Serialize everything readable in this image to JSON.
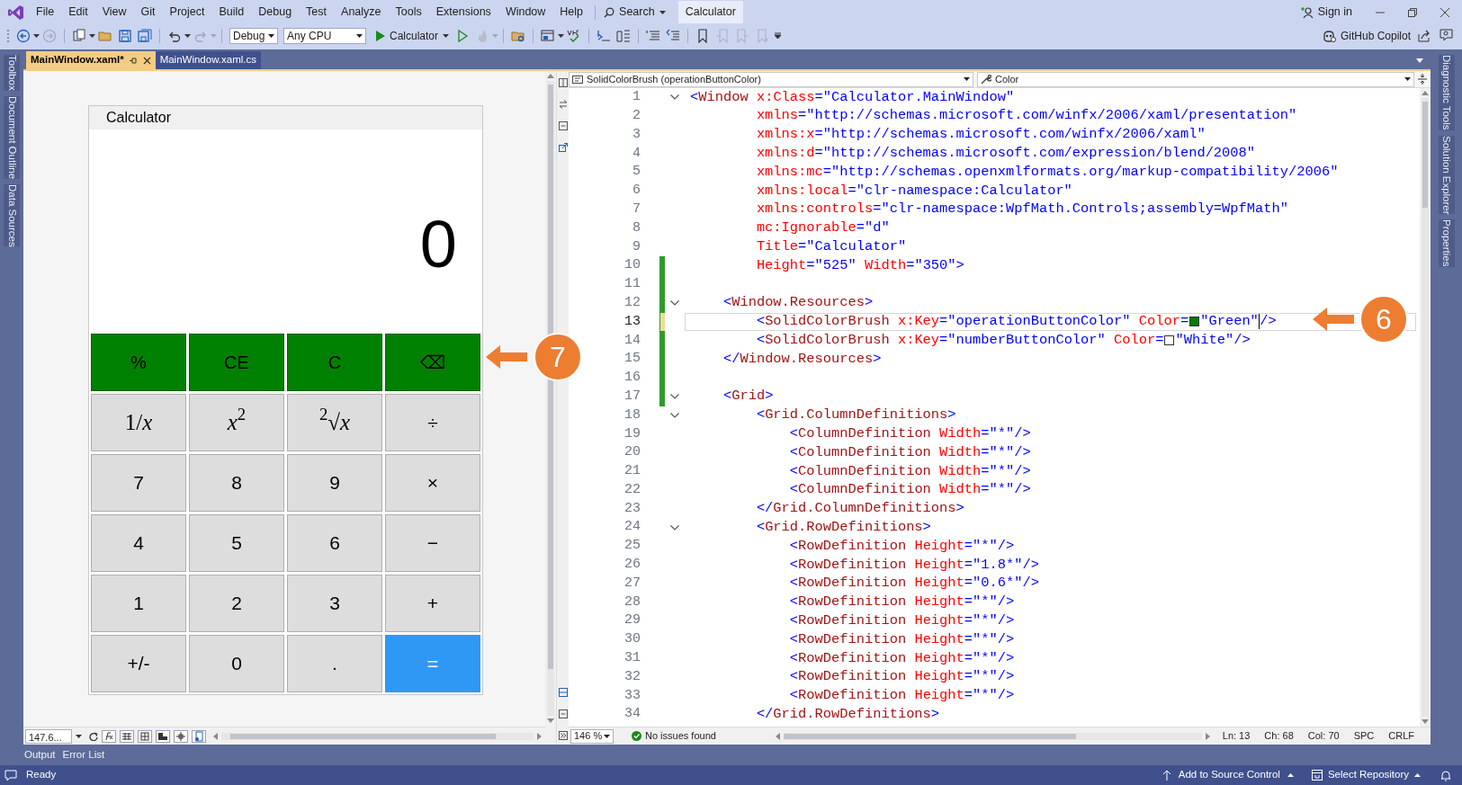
{
  "menu_bar": {
    "items": [
      "File",
      "Edit",
      "View",
      "Git",
      "Project",
      "Build",
      "Debug",
      "Test",
      "Analyze",
      "Tools",
      "Extensions",
      "Window",
      "Help"
    ],
    "search": "Search",
    "solution": "Calculator",
    "sign_in": "Sign in"
  },
  "toolbar": {
    "configuration": "Debug",
    "platform": "Any CPU",
    "start": "Calculator",
    "copilot": "GitHub Copilot"
  },
  "left_tool_tabs": [
    "Toolbox",
    "Document Outline",
    "Data Sources"
  ],
  "document_tabs": [
    {
      "label": "MainWindow.xaml*",
      "selected": true
    },
    {
      "label": "MainWindow.xaml.cs",
      "selected": false
    }
  ],
  "designer": {
    "window_title": "Calculator",
    "display": "0",
    "zoom": "147.6...",
    "buttons": [
      {
        "label": "%",
        "kind": "operation"
      },
      {
        "label": "CE",
        "kind": "operation"
      },
      {
        "label": "C",
        "kind": "operation"
      },
      {
        "label": "⌫",
        "kind": "operation"
      },
      {
        "label": "1/*x*",
        "kind": "function"
      },
      {
        "label": "*x*$^{2}$",
        "kind": "function"
      },
      {
        "label": "$^{2}$√*x*",
        "kind": "function"
      },
      {
        "label": "÷",
        "kind": "number"
      },
      {
        "label": "7",
        "kind": "number"
      },
      {
        "label": "8",
        "kind": "number"
      },
      {
        "label": "9",
        "kind": "number"
      },
      {
        "label": "×",
        "kind": "number"
      },
      {
        "label": "4",
        "kind": "number"
      },
      {
        "label": "5",
        "kind": "number"
      },
      {
        "label": "6",
        "kind": "number"
      },
      {
        "label": "−",
        "kind": "number"
      },
      {
        "label": "1",
        "kind": "number"
      },
      {
        "label": "2",
        "kind": "number"
      },
      {
        "label": "3",
        "kind": "number"
      },
      {
        "label": "+",
        "kind": "number"
      },
      {
        "label": "+/-",
        "kind": "number"
      },
      {
        "label": "0",
        "kind": "number"
      },
      {
        "label": ".",
        "kind": "number"
      },
      {
        "label": "=",
        "kind": "equals"
      }
    ]
  },
  "editor": {
    "member_dropdown": "SolidColorBrush (operationButtonColor)",
    "property_dropdown": "Color",
    "zoom": "146 %",
    "issues": "No issues found",
    "position": [
      "Ln: 13",
      "Ch: 68",
      "Col: 70",
      "SPC",
      "CRLF"
    ],
    "lines": [
      {
        "number": "1",
        "fold": true,
        "changed": false,
        "unsaved": false,
        "current": false,
        "tokens": [
          {
            "kind": "punct",
            "text": "<"
          },
          {
            "kind": "element",
            "text": "Window"
          },
          {
            "kind": "attr",
            "text": " x:Class"
          },
          {
            "kind": "value",
            "text": "=\"Calculator.MainWindow\""
          }
        ]
      },
      {
        "number": "2",
        "fold": false,
        "changed": false,
        "unsaved": false,
        "current": false,
        "tokens": [
          {
            "kind": "attr",
            "text": "        xmlns"
          },
          {
            "kind": "value",
            "text": "=\"http://schemas.microsoft.com/winfx/2006/xaml/presentation\""
          }
        ]
      },
      {
        "number": "3",
        "fold": false,
        "changed": false,
        "unsaved": false,
        "current": false,
        "tokens": [
          {
            "kind": "attr",
            "text": "        xmlns:x"
          },
          {
            "kind": "value",
            "text": "=\"http://schemas.microsoft.com/winfx/2006/xaml\""
          }
        ]
      },
      {
        "number": "4",
        "fold": false,
        "changed": false,
        "unsaved": false,
        "current": false,
        "tokens": [
          {
            "kind": "attr",
            "text": "        xmlns:d"
          },
          {
            "kind": "value",
            "text": "=\"http://schemas.microsoft.com/expression/blend/2008\""
          }
        ]
      },
      {
        "number": "5",
        "fold": false,
        "changed": false,
        "unsaved": false,
        "current": false,
        "tokens": [
          {
            "kind": "attr",
            "text": "        xmlns:mc"
          },
          {
            "kind": "value",
            "text": "=\"http://schemas.openxmlformats.org/markup-compatibility/2006\""
          }
        ]
      },
      {
        "number": "6",
        "fold": false,
        "changed": false,
        "unsaved": false,
        "current": false,
        "tokens": [
          {
            "kind": "attr",
            "text": "        xmlns:local"
          },
          {
            "kind": "value",
            "text": "=\"clr-namespace:Calculator\""
          }
        ]
      },
      {
        "number": "7",
        "fold": false,
        "changed": false,
        "unsaved": false,
        "current": false,
        "tokens": [
          {
            "kind": "attr",
            "text": "        xmlns:controls"
          },
          {
            "kind": "value",
            "text": "=\"clr-namespace:WpfMath.Controls;assembly=WpfMath\""
          }
        ]
      },
      {
        "number": "8",
        "fold": false,
        "changed": false,
        "unsaved": false,
        "current": false,
        "tokens": [
          {
            "kind": "attr",
            "text": "        mc:Ignorable"
          },
          {
            "kind": "value",
            "text": "=\"d\""
          }
        ]
      },
      {
        "number": "9",
        "fold": false,
        "changed": false,
        "unsaved": false,
        "current": false,
        "tokens": [
          {
            "kind": "attr",
            "text": "        Title"
          },
          {
            "kind": "value",
            "text": "=\"Calculator\""
          }
        ]
      },
      {
        "number": "10",
        "fold": false,
        "changed": true,
        "unsaved": false,
        "current": false,
        "tokens": [
          {
            "kind": "attr",
            "text": "        Height"
          },
          {
            "kind": "value",
            "text": "=\"525\""
          },
          {
            "kind": "attr",
            "text": " Width"
          },
          {
            "kind": "value",
            "text": "=\"350\""
          },
          {
            "kind": "punct",
            "text": ">"
          }
        ]
      },
      {
        "number": "11",
        "fold": false,
        "changed": true,
        "unsaved": false,
        "current": false
      },
      {
        "number": "12",
        "fold": true,
        "changed": true,
        "unsaved": false,
        "current": false,
        "tokens": [
          {
            "kind": "punct",
            "text": "    <"
          },
          {
            "kind": "element",
            "text": "Window.Resources"
          },
          {
            "kind": "punct",
            "text": ">"
          }
        ]
      },
      {
        "number": "13",
        "fold": false,
        "changed": true,
        "unsaved": true,
        "current": true,
        "tokens": [
          {
            "kind": "punct",
            "text": "        <"
          },
          {
            "kind": "element",
            "text": "SolidColorBrush"
          },
          {
            "kind": "attr",
            "text": " x:Key"
          },
          {
            "kind": "value",
            "text": "=\"operationButtonColor\""
          },
          {
            "kind": "attr",
            "text": " Color"
          },
          {
            "kind": "value",
            "text": "="
          },
          {
            "kind": "swatch",
            "color": "#008000"
          },
          {
            "kind": "value",
            "text": "\"Green\""
          },
          {
            "kind": "caret"
          },
          {
            "kind": "punct",
            "text": "/>"
          }
        ]
      },
      {
        "number": "14",
        "fold": false,
        "changed": true,
        "unsaved": false,
        "current": false,
        "tokens": [
          {
            "kind": "punct",
            "text": "        <"
          },
          {
            "kind": "element",
            "text": "SolidColorBrush"
          },
          {
            "kind": "attr",
            "text": " x:Key"
          },
          {
            "kind": "value",
            "text": "=\"numberButtonColor\""
          },
          {
            "kind": "attr",
            "text": " Color"
          },
          {
            "kind": "value",
            "text": "="
          },
          {
            "kind": "swatch",
            "color": "#ffffff"
          },
          {
            "kind": "value",
            "text": "\"White\""
          },
          {
            "kind": "punct",
            "text": "/>"
          }
        ]
      },
      {
        "number": "15",
        "fold": false,
        "changed": true,
        "unsaved": false,
        "current": false,
        "tokens": [
          {
            "kind": "punct",
            "text": "    </"
          },
          {
            "kind": "element",
            "text": "Window.Resources"
          },
          {
            "kind": "punct",
            "text": ">"
          }
        ]
      },
      {
        "number": "16",
        "fold": false,
        "changed": true,
        "unsaved": false,
        "current": false
      },
      {
        "number": "17",
        "fold": true,
        "changed": true,
        "unsaved": false,
        "current": false,
        "tokens": [
          {
            "kind": "punct",
            "text": "    <"
          },
          {
            "kind": "element",
            "text": "Grid"
          },
          {
            "kind": "punct",
            "text": ">"
          }
        ]
      },
      {
        "number": "18",
        "fold": true,
        "changed": false,
        "unsaved": false,
        "current": false,
        "tokens": [
          {
            "kind": "punct",
            "text": "        <"
          },
          {
            "kind": "element",
            "text": "Grid.ColumnDefinitions"
          },
          {
            "kind": "punct",
            "text": ">"
          }
        ]
      },
      {
        "number": "19",
        "fold": false,
        "changed": false,
        "unsaved": false,
        "current": false,
        "tokens": [
          {
            "kind": "punct",
            "text": "            <"
          },
          {
            "kind": "element",
            "text": "ColumnDefinition"
          },
          {
            "kind": "attr",
            "text": " Width"
          },
          {
            "kind": "value",
            "text": "=\"*\""
          },
          {
            "kind": "punct",
            "text": "/>"
          }
        ]
      },
      {
        "number": "20",
        "fold": false,
        "changed": false,
        "unsaved": false,
        "current": false,
        "tokens": [
          {
            "kind": "punct",
            "text": "            <"
          },
          {
            "kind": "element",
            "text": "ColumnDefinition"
          },
          {
            "kind": "attr",
            "text": " Width"
          },
          {
            "kind": "value",
            "text": "=\"*\""
          },
          {
            "kind": "punct",
            "text": "/>"
          }
        ]
      },
      {
        "number": "21",
        "fold": false,
        "changed": false,
        "unsaved": false,
        "current": false,
        "tokens": [
          {
            "kind": "punct",
            "text": "            <"
          },
          {
            "kind": "element",
            "text": "ColumnDefinition"
          },
          {
            "kind": "attr",
            "text": " Width"
          },
          {
            "kind": "value",
            "text": "=\"*\""
          },
          {
            "kind": "punct",
            "text": "/>"
          }
        ]
      },
      {
        "number": "22",
        "fold": false,
        "changed": false,
        "unsaved": false,
        "current": false,
        "tokens": [
          {
            "kind": "punct",
            "text": "            <"
          },
          {
            "kind": "element",
            "text": "ColumnDefinition"
          },
          {
            "kind": "attr",
            "text": " Width"
          },
          {
            "kind": "value",
            "text": "=\"*\""
          },
          {
            "kind": "punct",
            "text": "/>"
          }
        ]
      },
      {
        "number": "23",
        "fold": false,
        "changed": false,
        "unsaved": false,
        "current": false,
        "tokens": [
          {
            "kind": "punct",
            "text": "        </"
          },
          {
            "kind": "element",
            "text": "Grid.ColumnDefinitions"
          },
          {
            "kind": "punct",
            "text": ">"
          }
        ]
      },
      {
        "number": "24",
        "fold": true,
        "changed": false,
        "unsaved": false,
        "current": false,
        "tokens": [
          {
            "kind": "punct",
            "text": "        <"
          },
          {
            "kind": "element",
            "text": "Grid.RowDefinitions"
          },
          {
            "kind": "punct",
            "text": ">"
          }
        ]
      },
      {
        "number": "25",
        "fold": false,
        "changed": false,
        "unsaved": false,
        "current": false,
        "tokens": [
          {
            "kind": "punct",
            "text": "            <"
          },
          {
            "kind": "element",
            "text": "RowDefinition"
          },
          {
            "kind": "attr",
            "text": " Height"
          },
          {
            "kind": "value",
            "text": "=\"*\""
          },
          {
            "kind": "punct",
            "text": "/>"
          }
        ]
      },
      {
        "number": "26",
        "fold": false,
        "changed": false,
        "unsaved": false,
        "current": false,
        "tokens": [
          {
            "kind": "punct",
            "text": "            <"
          },
          {
            "kind": "element",
            "text": "RowDefinition"
          },
          {
            "kind": "attr",
            "text": " Height"
          },
          {
            "kind": "value",
            "text": "=\"1.8*\""
          },
          {
            "kind": "punct",
            "text": "/>"
          }
        ]
      },
      {
        "number": "27",
        "fold": false,
        "changed": false,
        "unsaved": false,
        "current": false,
        "tokens": [
          {
            "kind": "punct",
            "text": "            <"
          },
          {
            "kind": "element",
            "text": "RowDefinition"
          },
          {
            "kind": "attr",
            "text": " Height"
          },
          {
            "kind": "value",
            "text": "=\"0.6*\""
          },
          {
            "kind": "punct",
            "text": "/>"
          }
        ]
      },
      {
        "number": "28",
        "fold": false,
        "changed": false,
        "unsaved": false,
        "current": false,
        "tokens": [
          {
            "kind": "punct",
            "text": "            <"
          },
          {
            "kind": "element",
            "text": "RowDefinition"
          },
          {
            "kind": "attr",
            "text": " Height"
          },
          {
            "kind": "value",
            "text": "=\"*\""
          },
          {
            "kind": "punct",
            "text": "/>"
          }
        ]
      },
      {
        "number": "29",
        "fold": false,
        "changed": false,
        "unsaved": false,
        "current": false,
        "tokens": [
          {
            "kind": "punct",
            "text": "            <"
          },
          {
            "kind": "element",
            "text": "RowDefinition"
          },
          {
            "kind": "attr",
            "text": " Height"
          },
          {
            "kind": "value",
            "text": "=\"*\""
          },
          {
            "kind": "punct",
            "text": "/>"
          }
        ]
      },
      {
        "number": "30",
        "fold": false,
        "changed": false,
        "unsaved": false,
        "current": false,
        "tokens": [
          {
            "kind": "punct",
            "text": "            <"
          },
          {
            "kind": "element",
            "text": "RowDefinition"
          },
          {
            "kind": "attr",
            "text": " Height"
          },
          {
            "kind": "value",
            "text": "=\"*\""
          },
          {
            "kind": "punct",
            "text": "/>"
          }
        ]
      },
      {
        "number": "31",
        "fold": false,
        "changed": false,
        "unsaved": false,
        "current": false,
        "tokens": [
          {
            "kind": "punct",
            "text": "            <"
          },
          {
            "kind": "element",
            "text": "RowDefinition"
          },
          {
            "kind": "attr",
            "text": " Height"
          },
          {
            "kind": "value",
            "text": "=\"*\""
          },
          {
            "kind": "punct",
            "text": "/>"
          }
        ]
      },
      {
        "number": "32",
        "fold": false,
        "changed": false,
        "unsaved": false,
        "current": false,
        "tokens": [
          {
            "kind": "punct",
            "text": "            <"
          },
          {
            "kind": "element",
            "text": "RowDefinition"
          },
          {
            "kind": "attr",
            "text": " Height"
          },
          {
            "kind": "value",
            "text": "=\"*\""
          },
          {
            "kind": "punct",
            "text": "/>"
          }
        ]
      },
      {
        "number": "33",
        "fold": false,
        "changed": false,
        "unsaved": false,
        "current": false,
        "tokens": [
          {
            "kind": "punct",
            "text": "            <"
          },
          {
            "kind": "element",
            "text": "RowDefinition"
          },
          {
            "kind": "attr",
            "text": " Height"
          },
          {
            "kind": "value",
            "text": "=\"*\""
          },
          {
            "kind": "punct",
            "text": "/>"
          }
        ]
      },
      {
        "number": "34",
        "fold": false,
        "changed": false,
        "unsaved": false,
        "current": false,
        "tokens": [
          {
            "kind": "punct",
            "text": "        </"
          },
          {
            "kind": "element",
            "text": "Grid.RowDefinitions"
          },
          {
            "kind": "punct",
            "text": ">"
          }
        ]
      }
    ]
  },
  "right_tool_tabs": [
    "Diagnostic Tools",
    "Solution Explorer",
    "Properties"
  ],
  "bottom_tabs": [
    "Output",
    "Error List"
  ],
  "status_bar": {
    "message": "Ready",
    "source_control": "Add to Source Control",
    "repository": "Select Repository"
  },
  "callouts": [
    {
      "number": "7"
    },
    {
      "number": "6"
    }
  ]
}
